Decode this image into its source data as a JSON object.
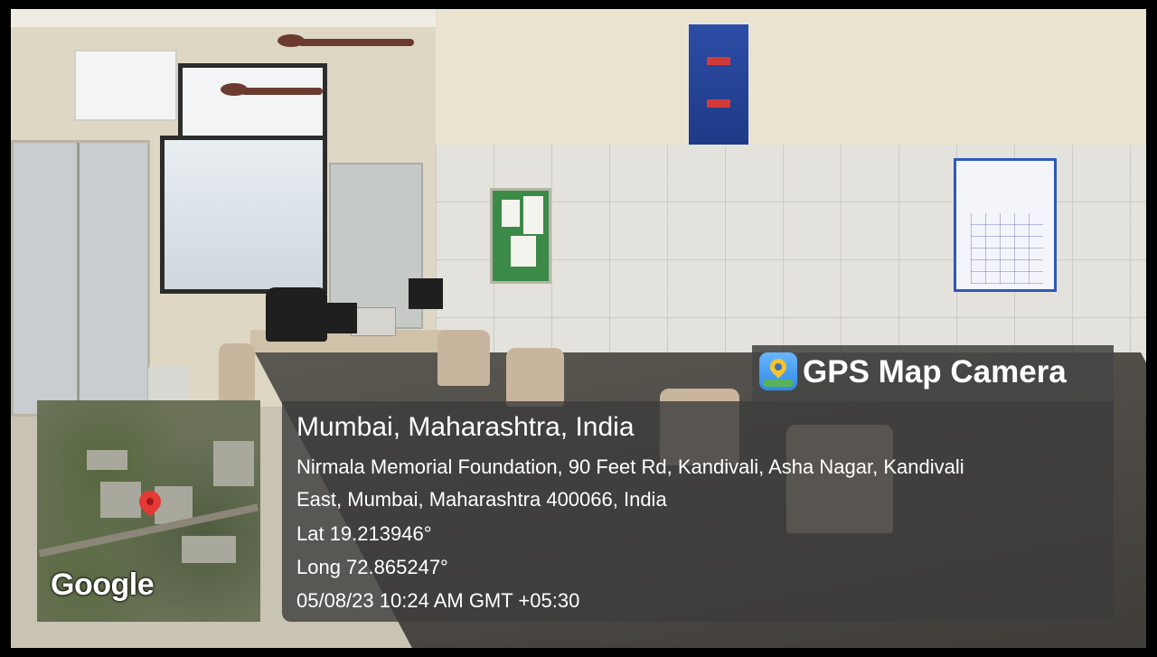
{
  "overlay": {
    "app_name": "GPS Map Camera",
    "app_icon": "gps-map-camera-icon",
    "place": "Mumbai, Maharashtra, India",
    "address_line1": "Nirmala Memorial Foundation, 90 Feet Rd, Kandivali, Asha Nagar, Kandivali",
    "address_line2": "East, Mumbai, Maharashtra 400066, India",
    "latitude": "Lat 19.213946°",
    "longitude": "Long 72.865247°",
    "datetime": "05/08/23 10:24 AM GMT +05:30"
  },
  "map": {
    "provider_logo": "Google",
    "pin_icon": "map-pin-icon"
  },
  "colors": {
    "overlay_bg": "#3c3c3c",
    "pin": "#e53935",
    "text": "#ffffff"
  }
}
